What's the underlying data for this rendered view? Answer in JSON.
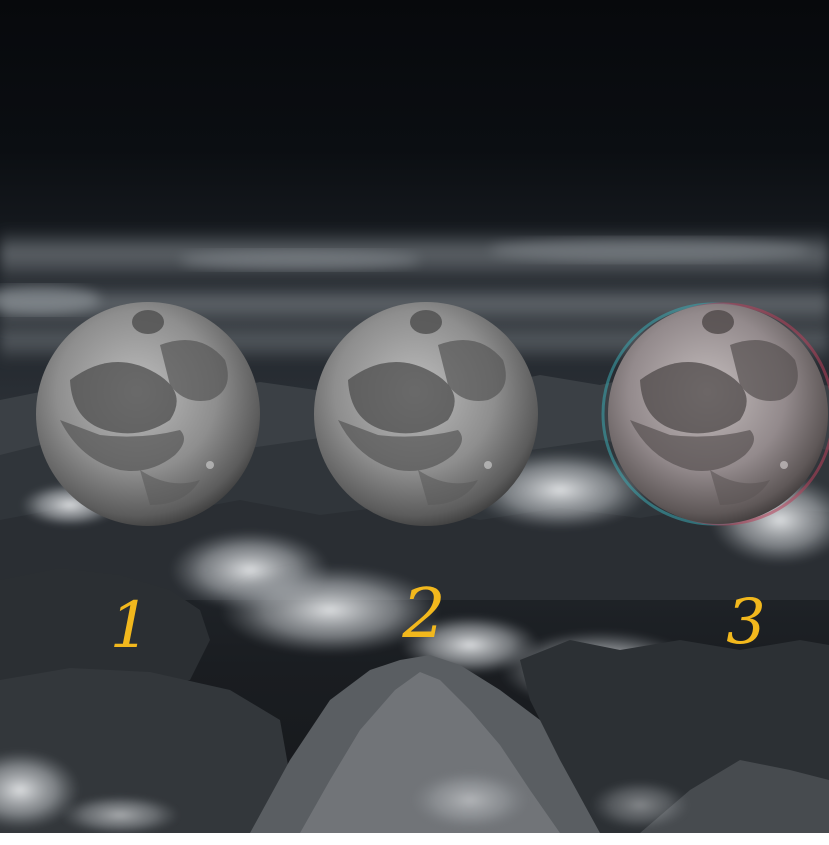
{
  "moons": [
    {
      "label": "1",
      "variant": "plain"
    },
    {
      "label": "2",
      "variant": "plain"
    },
    {
      "label": "3",
      "variant": "chromatic-fringe"
    }
  ],
  "colors": {
    "label_color": "#f2b81d",
    "sky_top": "#07090c",
    "cloud": "#cfd3d6",
    "mountain": "#2b2e31",
    "moon_base": "#9a9a9a",
    "moon_mare": "#4e4e4e"
  }
}
